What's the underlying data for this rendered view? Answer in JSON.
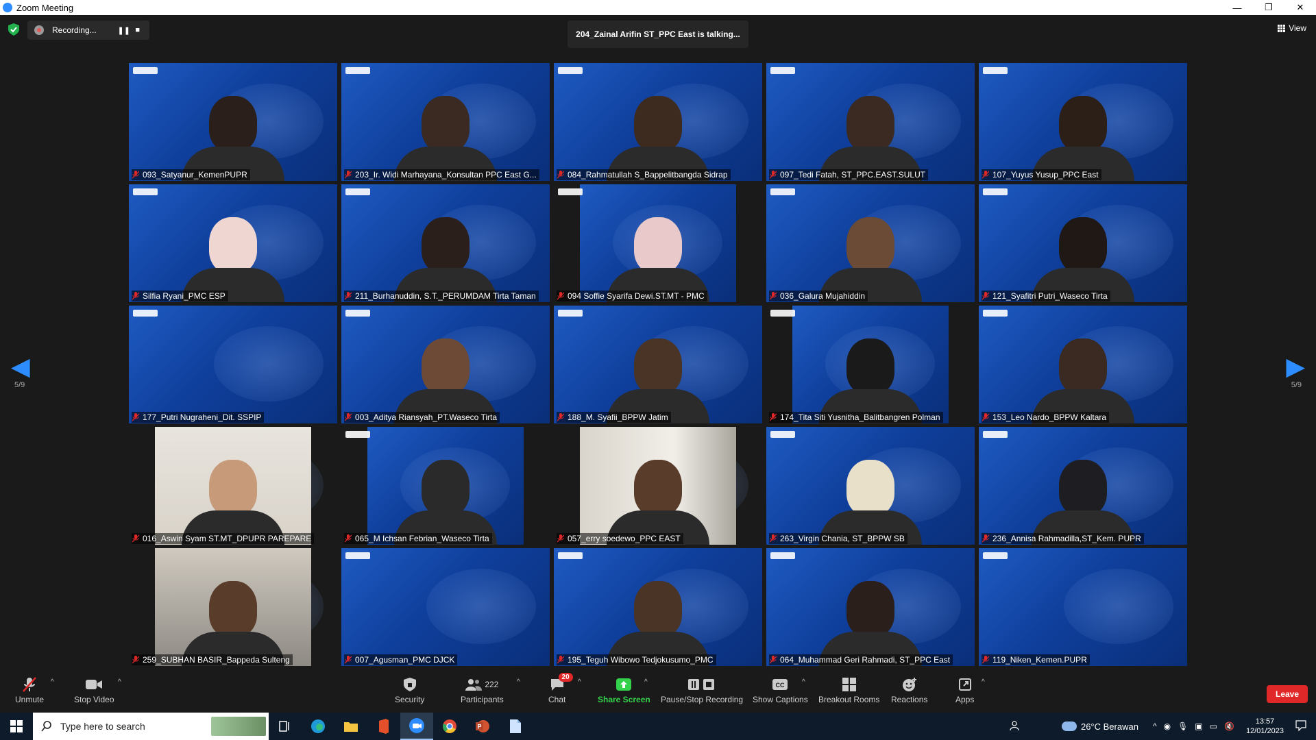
{
  "window": {
    "title": "Zoom Meeting",
    "controls": [
      "—",
      "❐",
      "✕"
    ]
  },
  "top": {
    "recording_label": "Recording...",
    "pause_glyph": "❚❚",
    "stop_glyph": "■",
    "talking_text": "204_Zainal Arifin ST_PPC East is talking...",
    "view_label": "View"
  },
  "nav": {
    "left_page": "5/9",
    "right_page": "5/9"
  },
  "tiles": [
    {
      "name": "093_Satyanur_KemenPUPR"
    },
    {
      "name": "203_Ir. Widi Marhayana_Konsultan PPC East G..."
    },
    {
      "name": "084_Rahmatullah S_Bappelitbangda Sidrap"
    },
    {
      "name": "097_Tedi Fatah, ST_PPC.EAST.SULUT"
    },
    {
      "name": "107_Yuyus Yusup_PPC East"
    },
    {
      "name": "Silfia Ryani_PMC ESP"
    },
    {
      "name": "211_Burhanuddin, S.T._PERUMDAM Tirta Taman"
    },
    {
      "name": "094 Soffie Syarifa Dewi.ST.MT - PMC"
    },
    {
      "name": "036_Galura Mujahiddin"
    },
    {
      "name": "121_Syafitri Putri_Waseco Tirta"
    },
    {
      "name": "177_Putri Nugraheni_Dit. SSPIP"
    },
    {
      "name": "003_Aditya Riansyah_PT.Waseco Tirta"
    },
    {
      "name": "188_M. Syafii_BPPW Jatim"
    },
    {
      "name": "174_Tita Siti Yusnitha_Balitbangren Polman"
    },
    {
      "name": "153_Leo Nardo_BPPW Kaltara"
    },
    {
      "name": "016_Aswin Syam ST.MT_DPUPR PAREPARE"
    },
    {
      "name": "065_M Ichsan Febrian_Waseco Tirta"
    },
    {
      "name": "057_erry soedewo_PPC EAST"
    },
    {
      "name": "263_Virgin Chania, ST_BPPW SB"
    },
    {
      "name": "236_Annisa Rahmadilla,ST_Kem. PUPR"
    },
    {
      "name": "259_SUBHAN BASIR_Bappeda Sulteng"
    },
    {
      "name": "007_Agusman_PMC DJCK"
    },
    {
      "name": "195_Teguh Wibowo Tedjokusumo_PMC"
    },
    {
      "name": "064_Muhammad Geri Rahmadi, ST_PPC East"
    },
    {
      "name": "119_Niken_Kemen.PUPR"
    }
  ],
  "toolbar": {
    "unmute": "Unmute",
    "stop_video": "Stop Video",
    "security": "Security",
    "participants": "Participants",
    "participants_count": "222",
    "chat": "Chat",
    "chat_badge": "20",
    "share_screen": "Share Screen",
    "pause_stop_recording": "Pause/Stop Recording",
    "show_captions": "Show Captions",
    "breakout_rooms": "Breakout Rooms",
    "reactions": "Reactions",
    "apps": "Apps",
    "leave": "Leave",
    "caret": "^"
  },
  "taskbar": {
    "search_placeholder": "Type here to search",
    "weather": "26°C  Berawan",
    "time": "13:57",
    "date": "12/01/2023"
  },
  "colors": {
    "accent": "#2d8cff",
    "green": "#33d24a",
    "leave": "#e02828",
    "tile_bg": "#0f3f9c"
  }
}
